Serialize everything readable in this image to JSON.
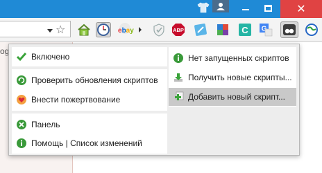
{
  "window": {
    "close_glyph": "✕",
    "accent_color": "#1f8ad6",
    "close_color": "#e04343"
  },
  "toolbar": {
    "extensions": [
      {
        "name": "home-icon"
      },
      {
        "name": "clock-icon"
      },
      {
        "name": "ebay-icon",
        "label": "ebay"
      },
      {
        "name": "shield-icon"
      },
      {
        "name": "adblock-plus-icon",
        "label": "ABP"
      },
      {
        "name": "note-icon"
      },
      {
        "name": "puzzle-icon"
      },
      {
        "name": "c-extension-icon",
        "label": "C"
      },
      {
        "name": "google-translate-icon",
        "label": "G"
      },
      {
        "name": "tampermonkey-icon"
      },
      {
        "name": "globe-icon"
      }
    ]
  },
  "page": {
    "fragment": "og"
  },
  "menu": {
    "left": {
      "enabled": "Включено",
      "check_updates": "Проверить обновления скриптов",
      "donate": "Внести пожертвование",
      "dashboard": "Панель",
      "help": "Помощь | Список изменений"
    },
    "right": {
      "no_scripts": "Нет запущенных скриптов",
      "get_scripts": "Получить новые скрипты...",
      "add_script": "Добавить новый скрипт..."
    },
    "highlight_color": "#c9c9c9"
  }
}
